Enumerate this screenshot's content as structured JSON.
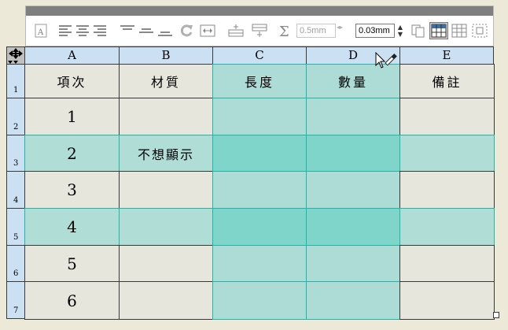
{
  "toolbar": {
    "stroke_width_value": "0.5mm",
    "line_width_value": "0.03mm",
    "icons": [
      "text-style-icon",
      "align-left-icon",
      "align-center-icon",
      "align-right-icon",
      "valign-top-icon",
      "valign-middle-icon",
      "valign-bottom-icon",
      "rotate-icon",
      "fit-icon",
      "insert-row-above-icon",
      "insert-row-below-icon",
      "sum-icon",
      "copy-format-icon",
      "table-select-icon",
      "grid-icon",
      "merge-icon"
    ]
  },
  "table": {
    "columns": [
      "A",
      "B",
      "C",
      "D",
      "E"
    ],
    "row_numbers": [
      "1",
      "2",
      "3",
      "4",
      "5",
      "6",
      "7"
    ],
    "header_row": [
      "項次",
      "材質",
      "長度",
      "數量",
      "備註"
    ],
    "rows": [
      [
        "1",
        "",
        "",
        "",
        ""
      ],
      [
        "2",
        "不想顯示",
        "",
        "",
        ""
      ],
      [
        "3",
        "",
        "",
        "",
        ""
      ],
      [
        "4",
        "",
        "",
        "",
        ""
      ],
      [
        "5",
        "",
        "",
        "",
        ""
      ],
      [
        "6",
        "",
        "",
        "",
        ""
      ]
    ],
    "colors": {
      "header_bg": "#cce0f4",
      "cell_bg": "#e6e6dc",
      "col_highlight": "#acdcd5",
      "row_highlight": "#b0ddd6",
      "intersection": "#7fd5ca",
      "highlight_border": "#1fb5a8"
    }
  }
}
